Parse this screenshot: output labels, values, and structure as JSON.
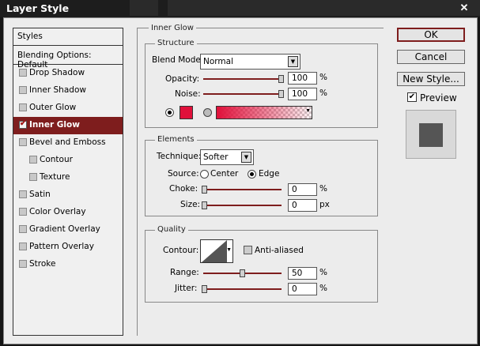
{
  "window": {
    "title": "Layer Style"
  },
  "icons": {
    "close": "close-icon",
    "check": "checkmark-icon"
  },
  "colors": {
    "accent": "#7e1d1d",
    "glow_color": "#e0103a"
  },
  "sidebar": {
    "items": [
      {
        "label": "Styles",
        "type": "header"
      },
      {
        "label": "Blending Options: Default",
        "type": "header"
      },
      {
        "label": "Drop Shadow",
        "checked": false
      },
      {
        "label": "Inner Shadow",
        "checked": false
      },
      {
        "label": "Outer Glow",
        "checked": false
      },
      {
        "label": "Inner Glow",
        "checked": true,
        "active": true
      },
      {
        "label": "Bevel and Emboss",
        "checked": false
      },
      {
        "label": "Contour",
        "checked": false,
        "sub": true
      },
      {
        "label": "Texture",
        "checked": false,
        "sub": true
      },
      {
        "label": "Satin",
        "checked": false
      },
      {
        "label": "Color Overlay",
        "checked": false
      },
      {
        "label": "Gradient Overlay",
        "checked": false
      },
      {
        "label": "Pattern Overlay",
        "checked": false
      },
      {
        "label": "Stroke",
        "checked": false
      }
    ]
  },
  "panel": {
    "title": "Inner Glow",
    "structure": {
      "label": "Structure",
      "blend_mode_label": "Blend Mode:",
      "blend_mode": "Normal",
      "opacity_label": "Opacity:",
      "opacity": "100",
      "opacity_unit": "%",
      "opacity_level": 1.0,
      "noise_label": "Noise:",
      "noise": "100",
      "noise_unit": "%",
      "noise_level": 1.0,
      "fill_mode": "color"
    },
    "elements": {
      "label": "Elements",
      "technique_label": "Technique:",
      "technique": "Softer",
      "source_label": "Source:",
      "source_center": "Center",
      "source_edge": "Edge",
      "source_selected": "Edge",
      "choke_label": "Choke:",
      "choke": "0",
      "choke_unit": "%",
      "size_label": "Size:",
      "size": "0",
      "size_unit": "px"
    },
    "quality": {
      "label": "Quality",
      "contour_label": "Contour:",
      "anti_aliased_label": "Anti-aliased",
      "anti_aliased": false,
      "range_label": "Range:",
      "range": "50",
      "range_unit": "%",
      "range_level": 0.5,
      "jitter_label": "Jitter:",
      "jitter": "0",
      "jitter_unit": "%"
    }
  },
  "buttons": {
    "ok": "OK",
    "cancel": "Cancel",
    "new_style": "New Style...",
    "preview_label": "Preview",
    "preview_checked": true
  }
}
